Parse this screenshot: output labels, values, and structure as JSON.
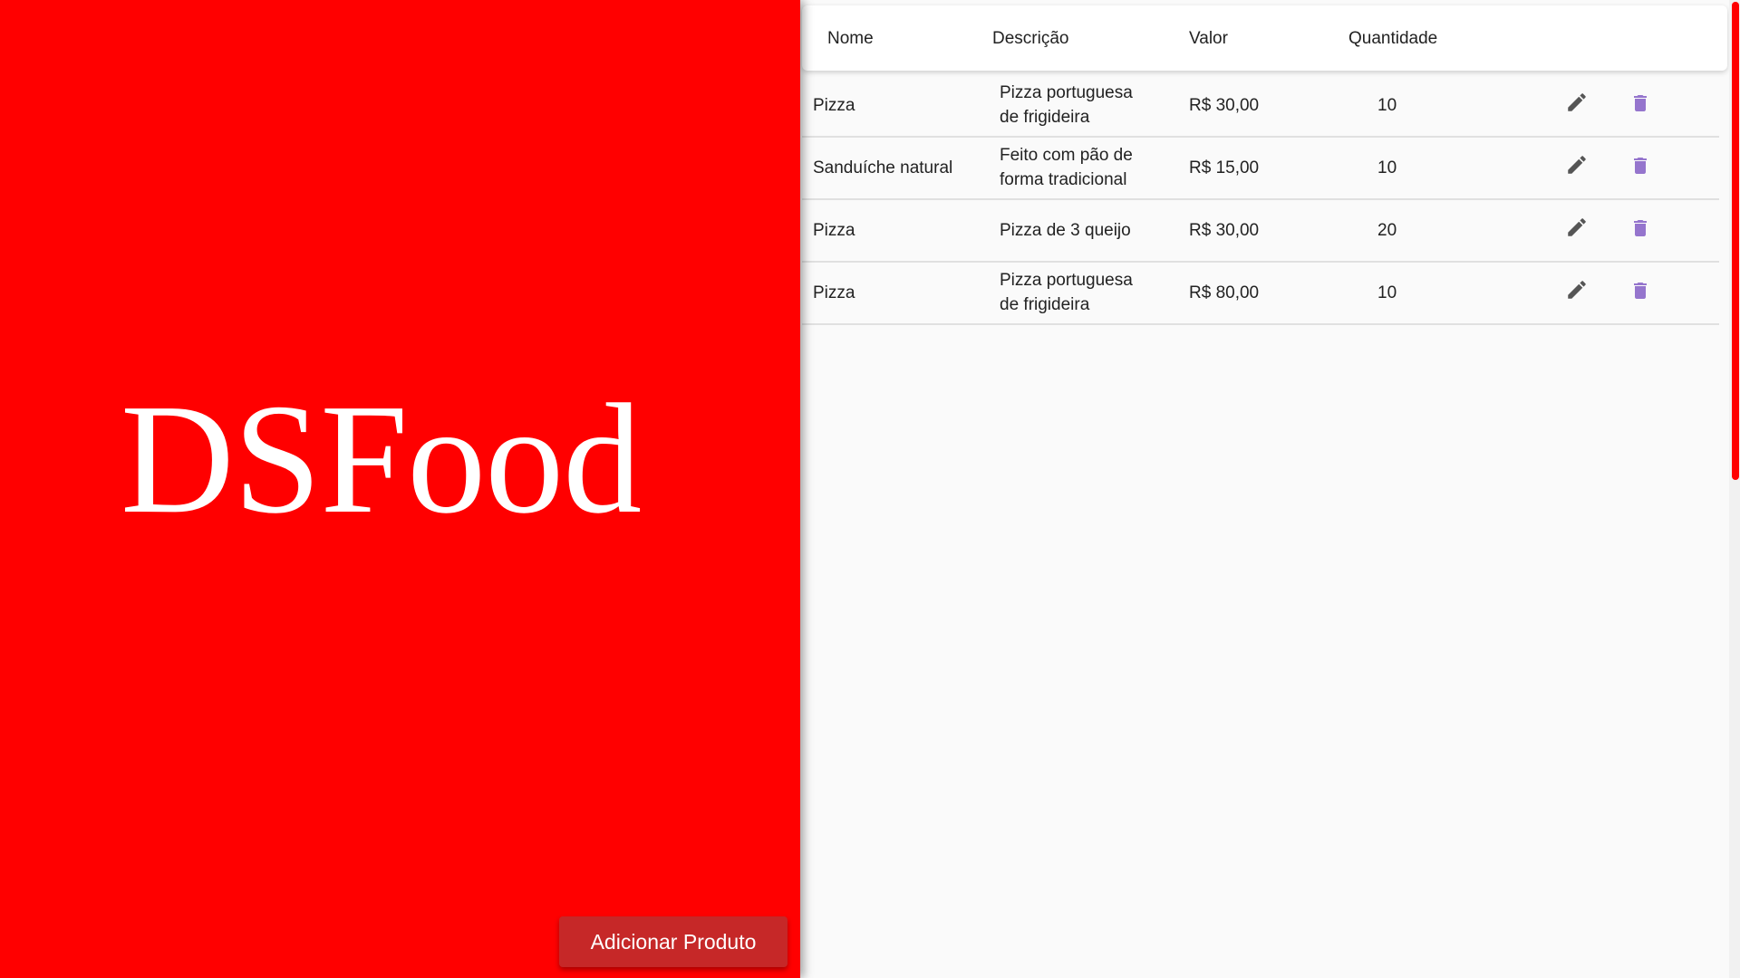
{
  "brand": {
    "title": "DSFood"
  },
  "actions": {
    "add_product_label": "Adicionar Produto"
  },
  "table": {
    "headers": [
      "Nome",
      "Descrição",
      "Valor",
      "Quantidade"
    ],
    "rows": [
      {
        "name": "Pizza",
        "description_lines": [
          "Pizza portuguesa",
          "de frigideira"
        ],
        "value": "R$ 30,00",
        "quantity": "10"
      },
      {
        "name": "Sanduíche natural",
        "description_lines": [
          "Feito com pão de",
          "forma tradicional"
        ],
        "value": "R$ 15,00",
        "quantity": "10"
      },
      {
        "name": "Pizza",
        "description_lines": [
          "Pizza de 3 queijo"
        ],
        "value": "R$ 30,00",
        "quantity": "20"
      },
      {
        "name": "Pizza",
        "description_lines": [
          "Pizza portuguesa",
          "de frigideira"
        ],
        "value": "R$ 80,00",
        "quantity": "10"
      }
    ],
    "row_icons": {
      "edit": "pencil-icon",
      "delete": "trash-icon"
    }
  },
  "colors": {
    "brand_red": "#ff0000",
    "button_red": "#c62828",
    "edit_icon": "#555555",
    "delete_icon": "#9575cd"
  }
}
